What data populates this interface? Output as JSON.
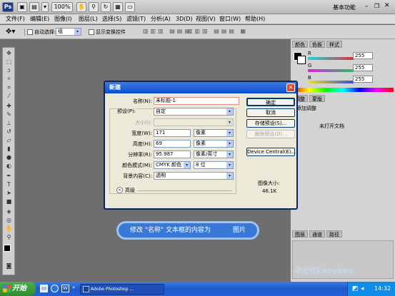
{
  "app": {
    "workspace_label": "基本功能",
    "zoom": "100%",
    "window_controls": [
      "minimize",
      "restore",
      "close"
    ]
  },
  "menu": [
    "文件(F)",
    "编辑(E)",
    "图像(I)",
    "图层(L)",
    "选择(S)",
    "滤镜(T)",
    "分析(A)",
    "3D(D)",
    "视图(V)",
    "窗口(W)",
    "帮助(H)"
  ],
  "options_bar": {
    "auto_select_label": "自动选择:",
    "auto_select_value": "组",
    "show_transform_label": "显示变换控件"
  },
  "panels": {
    "color_tab": "颜色",
    "swatches_tab": "色板",
    "styles_tab": "样式",
    "rgb_labels": [
      "R",
      "G",
      "B"
    ],
    "rgb_values": [
      "255",
      "255",
      "255"
    ],
    "adjust_tab": "调整",
    "masks_tab": "蒙版",
    "adjust_heading": "添加调整",
    "no_document": "未打开文档",
    "layers_tab": "图层",
    "channels_tab": "通道",
    "paths_tab": "路径"
  },
  "dialog": {
    "title": "新建",
    "name_label": "名称(N):",
    "name_value": "未标题-1",
    "preset_label": "预设(P):",
    "preset_value": "自定",
    "size_label": "大小(I):",
    "width_label": "宽度(W):",
    "width_value": "171",
    "width_unit": "像素",
    "height_label": "高度(H):",
    "height_value": "69",
    "height_unit": "像素",
    "resolution_label": "分辨率(R):",
    "resolution_value": "95.987",
    "resolution_unit": "像素/英寸",
    "color_mode_label": "颜色模式(M):",
    "color_mode_value": "CMYK 颜色",
    "bit_depth_value": "8 位",
    "background_label": "背景内容(C):",
    "background_value": "透明",
    "advanced_label": "高级",
    "ok_button": "确定",
    "cancel_button": "取消",
    "save_preset_button": "存储预设(S)...",
    "delete_preset_button": "删除预设(D)...",
    "device_central_button": "Device Central(E)...",
    "image_size_label": "图像大小:",
    "image_size_value": "46.1K"
  },
  "hint": {
    "text_prefix": "修改 \"名称\" 文本框的内容为",
    "text_highlight": "图片"
  },
  "taskbar": {
    "start_label": "开始",
    "task_item": "Adobe Photoshop ...",
    "time": "14:32",
    "watermark": "考无忧Easykao"
  },
  "colors": {
    "accent_blue": "#0a4fd0",
    "hint_blue": "#3a78d8",
    "slider_r": "#e0303a",
    "slider_g": "#28c060",
    "slider_b": "#3050e0"
  }
}
